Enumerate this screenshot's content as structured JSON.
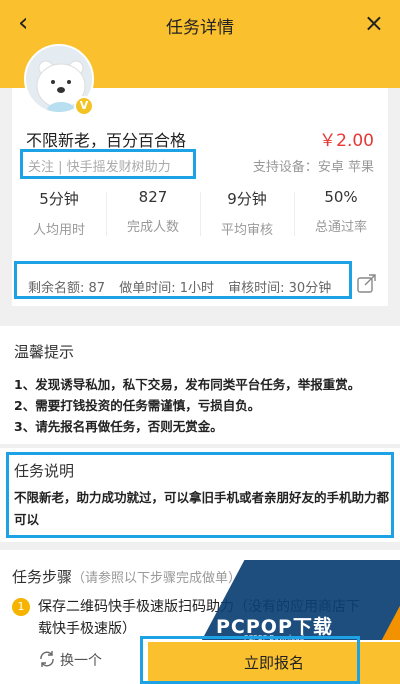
{
  "header": {
    "back_glyph": "‹",
    "title": "任务详情",
    "close_glyph": "×"
  },
  "task": {
    "title": "不限新老，百分百合格",
    "price": "￥2.00",
    "tags": "关注 | 快手摇发财树助力",
    "device_label": "支持设备：安卓  苹果",
    "avatar_badge": "V"
  },
  "stats": [
    {
      "value": "5分钟",
      "label": "人均用时"
    },
    {
      "value": "827",
      "label": "完成人数"
    },
    {
      "value": "9分钟",
      "label": "平均审核"
    },
    {
      "value": "50%",
      "label": "总通过率"
    }
  ],
  "info": {
    "remaining": "剩余名额: 87",
    "do_time": "做单时间: 1小时",
    "review_time": "审核时间: 30分钟"
  },
  "tips": {
    "title": "温馨提示",
    "lines": [
      "1、发现诱导私加，私下交易，发布同类平台任务，举报重赏。",
      "2、需要打钱投资的任务需谨慎，亏损自负。",
      "3、请先报名再做任务，否则无赏金。"
    ]
  },
  "description": {
    "title": "任务说明",
    "text": "不限新老，助力成功就过，可以拿旧手机或者亲朋好友的手机助力都可以"
  },
  "steps": {
    "title": "任务步骤",
    "subtitle": "（请参照以下步骤完成做单）",
    "items": [
      {
        "num": "1",
        "text": "保存二维码快手极速版扫码助力（没有的应用商店下载快手极速版）"
      }
    ]
  },
  "bottom": {
    "refresh_label": "换一个",
    "signup_label": "立即报名"
  },
  "watermark": {
    "logo": "PCPOP下载",
    "sub": "PCPOP Download"
  },
  "colors": {
    "brand_yellow": "#fbc02d",
    "price_red": "#e53935",
    "highlight_blue": "#1ea2e6"
  }
}
